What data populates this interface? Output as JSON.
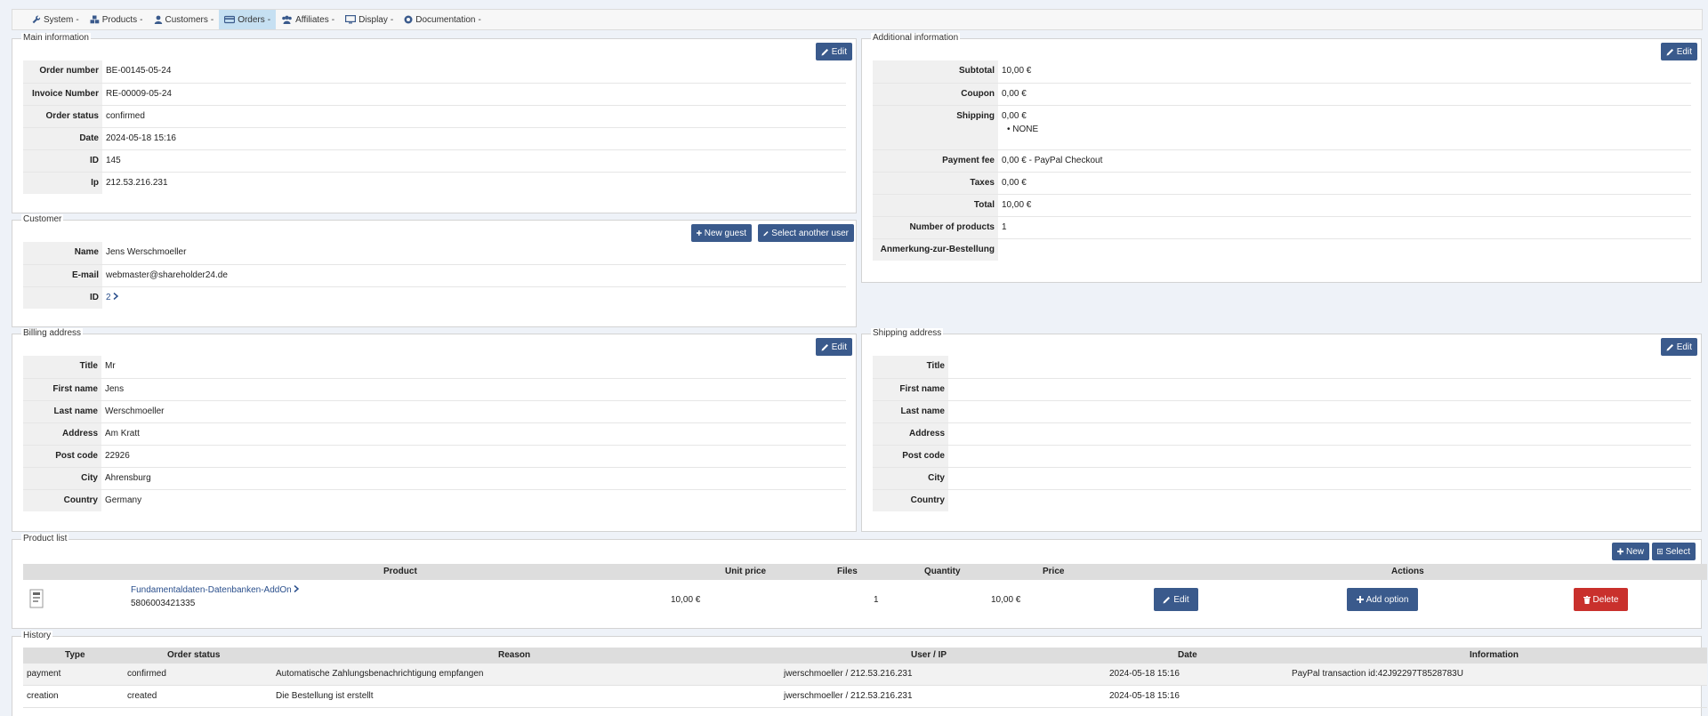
{
  "menu": [
    {
      "label": "System",
      "icon": "wrench-icon"
    },
    {
      "label": "Products",
      "icon": "cubes-icon"
    },
    {
      "label": "Customers",
      "icon": "user-icon"
    },
    {
      "label": "Orders",
      "icon": "credit-card-icon"
    },
    {
      "label": "Affiliates",
      "icon": "users-icon"
    },
    {
      "label": "Display",
      "icon": "monitor-icon"
    },
    {
      "label": "Documentation",
      "icon": "help-icon"
    }
  ],
  "menu_caret": "-",
  "main_info": {
    "title": "Main information",
    "edit_label": "Edit",
    "rows": [
      {
        "key": "Order number",
        "value": "BE-00145-05-24"
      },
      {
        "key": "Invoice Number",
        "value": "RE-00009-05-24"
      },
      {
        "key": "Order status",
        "value": "confirmed"
      },
      {
        "key": "Date",
        "value": "2024-05-18 15:16"
      },
      {
        "key": "ID",
        "value": "145"
      },
      {
        "key": "Ip",
        "value": "212.53.216.231"
      }
    ]
  },
  "customer": {
    "title": "Customer",
    "new_guest_label": "New guest",
    "select_user_label": "Select another user",
    "rows": [
      {
        "key": "Name",
        "value": "Jens Werschmoeller"
      },
      {
        "key": "E-mail",
        "value": "webmaster@shareholder24.de"
      },
      {
        "key": "ID",
        "value": "2"
      }
    ]
  },
  "additional_info": {
    "title": "Additional information",
    "edit_label": "Edit",
    "subtotal_key": "Subtotal",
    "subtotal": "10,00 €",
    "coupon_key": "Coupon",
    "coupon": "0,00 €",
    "shipping_key": "Shipping",
    "shipping": "0,00 €",
    "shipping_method": "NONE",
    "payment_fee_key": "Payment fee",
    "payment_fee": "0,00 € - PayPal Checkout",
    "taxes_key": "Taxes",
    "taxes": "0,00 €",
    "total_key": "Total",
    "total": "10,00 €",
    "num_products_key": "Number of products",
    "num_products": "1",
    "note_key": "Anmerkung-zur-Bestellung",
    "note": ""
  },
  "billing": {
    "title": "Billing address",
    "edit_label": "Edit",
    "rows": [
      {
        "key": "Title",
        "value": "Mr"
      },
      {
        "key": "First name",
        "value": "Jens"
      },
      {
        "key": "Last name",
        "value": "Werschmoeller"
      },
      {
        "key": "Address",
        "value": "Am Kratt"
      },
      {
        "key": "Post code",
        "value": "22926"
      },
      {
        "key": "City",
        "value": "Ahrensburg"
      },
      {
        "key": "Country",
        "value": "Germany"
      }
    ]
  },
  "shipping_addr": {
    "title": "Shipping address",
    "edit_label": "Edit",
    "rows": [
      {
        "key": "Title",
        "value": ""
      },
      {
        "key": "First name",
        "value": ""
      },
      {
        "key": "Last name",
        "value": ""
      },
      {
        "key": "Address",
        "value": ""
      },
      {
        "key": "Post code",
        "value": ""
      },
      {
        "key": "City",
        "value": ""
      },
      {
        "key": "Country",
        "value": ""
      }
    ]
  },
  "product_list": {
    "title": "Product list",
    "new_label": "New",
    "select_label": "Select",
    "headers": {
      "product": "Product",
      "unit_price": "Unit price",
      "files": "Files",
      "quantity": "Quantity",
      "price": "Price",
      "actions": "Actions"
    },
    "item": {
      "name": "Fundamentaldaten-Datenbanken-AddOn",
      "code": "5806003421335",
      "unit_price": "10,00 €",
      "quantity": "1",
      "price": "10,00 €",
      "edit_label": "Edit",
      "add_option_label": "Add option",
      "delete_label": "Delete"
    }
  },
  "history": {
    "title": "History",
    "headers": {
      "type": "Type",
      "status": "Order status",
      "reason": "Reason",
      "user": "User / IP",
      "date": "Date",
      "info": "Information"
    },
    "rows": [
      {
        "type": "payment",
        "status": "confirmed",
        "reason": "Automatische Zahlungsbenachrichtigung empfangen",
        "user": "jwerschmoeller / 212.53.216.231",
        "date": "2024-05-18 15:16",
        "info": "PayPal transaction id:42J92297T8528783U"
      },
      {
        "type": "creation",
        "status": "created",
        "reason": "Die Bestellung ist erstellt",
        "user": "jwerschmoeller / 212.53.216.231",
        "date": "2024-05-18 15:16",
        "info": ""
      }
    ]
  }
}
